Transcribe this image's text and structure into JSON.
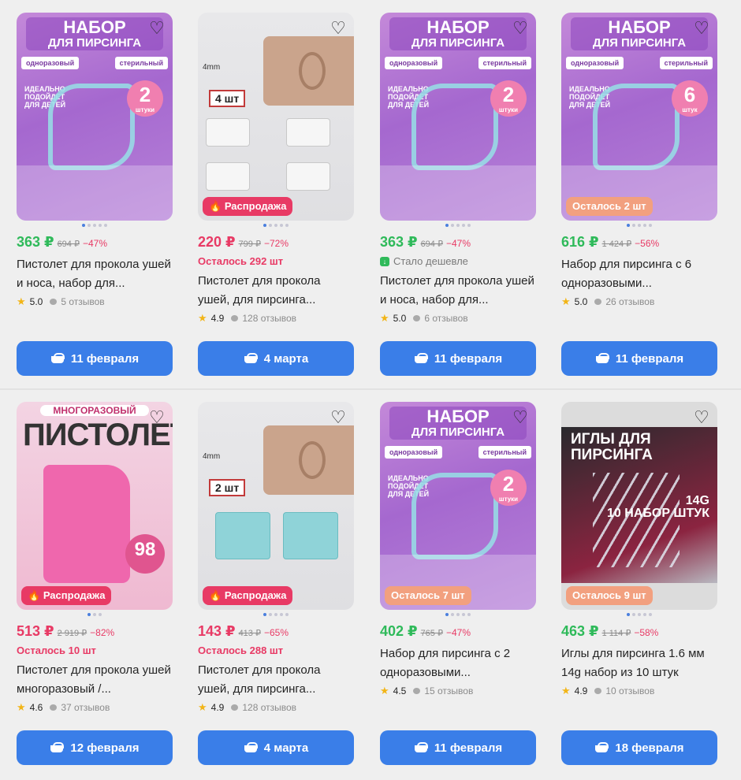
{
  "icons": {
    "favorite": "heart-outline-icon",
    "cart": "basket-icon",
    "star": "star-icon",
    "reviews": "speech-bubble-icon",
    "sale": "fire-icon",
    "cheaper": "price-drop-icon"
  },
  "colors": {
    "button": "#3a7ee8",
    "price_green": "#2fba5a",
    "price_red": "#e83a65",
    "badge_sale": "#e83a65",
    "badge_left": "#f2a07f"
  },
  "products": [
    {
      "img_title": "НАБОР",
      "img_sub": "ДЛЯ ПИРСИНГА",
      "img_tag1": "одноразовый",
      "img_tag2": "стерильный",
      "img_note": "ИДЕАЛЬНО ПОДОЙДЕТ ДЛЯ ДЕТЕЙ",
      "img_count": "2",
      "img_count_unit": "штуки",
      "price": "363 ₽",
      "old_price": "694 ₽",
      "discount": "−47%",
      "title": "Пистолет для прокола ушей и носа, набор для...",
      "rating": "5.0",
      "reviews": "5 отзывов",
      "delivery": "11 февраля"
    },
    {
      "img_size": "4mm",
      "img_qty": "4 шт",
      "badge": "Распродажа",
      "price": "220 ₽",
      "old_price": "799 ₽",
      "discount": "−72%",
      "stock": "Осталось 292 шт",
      "title": "Пистолет для прокола ушей, для пирсинга...",
      "rating": "4.9",
      "reviews": "128 отзывов",
      "delivery": "4 марта"
    },
    {
      "img_title": "НАБОР",
      "img_sub": "ДЛЯ ПИРСИНГА",
      "img_tag1": "одноразовый",
      "img_tag2": "стерильный",
      "img_note": "ИДЕАЛЬНО ПОДОЙДЕТ ДЛЯ ДЕТЕЙ",
      "img_count": "2",
      "img_count_unit": "штуки",
      "price": "363 ₽",
      "old_price": "694 ₽",
      "discount": "−47%",
      "cheaper": "Стало дешевле",
      "title": "Пистолет для прокола ушей и носа, набор для...",
      "rating": "5.0",
      "reviews": "6 отзывов",
      "delivery": "11 февраля"
    },
    {
      "img_title": "НАБОР",
      "img_sub": "ДЛЯ ПИРСИНГА",
      "img_tag1": "одноразовый",
      "img_tag2": "стерильный",
      "img_note": "ИДЕАЛЬНО ПОДОЙДЕТ ДЛЯ ДЕТЕЙ",
      "img_count": "6",
      "img_count_unit": "штук",
      "badge": "Осталось 2 шт",
      "price": "616 ₽",
      "old_price": "1 424 ₽",
      "discount": "−56%",
      "title": "Набор для пирсинга с 6 одноразовыми...",
      "rating": "5.0",
      "reviews": "26 отзывов",
      "delivery": "11 февраля"
    },
    {
      "img_top": "МНОГОРАЗОВЫЙ",
      "img_title": "ПИСТОЛЕТ",
      "img_count": "98",
      "badge": "Распродажа",
      "price": "513 ₽",
      "old_price": "2 919 ₽",
      "discount": "−82%",
      "stock": "Осталось 10 шт",
      "title": "Пистолет для прокола ушей многоразовый /...",
      "rating": "4.6",
      "reviews": "37 отзывов",
      "delivery": "12 февраля"
    },
    {
      "img_size": "4mm",
      "img_qty": "2 шт",
      "badge": "Распродажа",
      "price": "143 ₽",
      "old_price": "413 ₽",
      "discount": "−65%",
      "stock": "Осталось 288 шт",
      "title": "Пистолет для прокола ушей, для пирсинга...",
      "rating": "4.9",
      "reviews": "128 отзывов",
      "delivery": "4 марта"
    },
    {
      "img_title": "НАБОР",
      "img_sub": "ДЛЯ ПИРСИНГА",
      "img_tag1": "одноразовый",
      "img_tag2": "стерильный",
      "img_note": "ИДЕАЛЬНО ПОДОЙДЕТ ДЛЯ ДЕТЕЙ",
      "img_count": "2",
      "img_count_unit": "штуки",
      "badge": "Осталось 7 шт",
      "price": "402 ₽",
      "old_price": "765 ₽",
      "discount": "−47%",
      "title": "Набор для пирсинга с 2 одноразовыми...",
      "rating": "4.5",
      "reviews": "15 отзывов",
      "delivery": "11 февраля"
    },
    {
      "img_title": "ИГЛЫ ДЛЯ ПИРСИНГА",
      "img_sub": "14G",
      "img_note": "10 НАБОР ШТУК",
      "badge": "Осталось 9 шт",
      "price": "463 ₽",
      "old_price": "1 114 ₽",
      "discount": "−58%",
      "title": "Иглы для пирсинга 1.6 мм 14g набор из 10 штук",
      "rating": "4.9",
      "reviews": "10 отзывов",
      "delivery": "18 февраля"
    }
  ]
}
